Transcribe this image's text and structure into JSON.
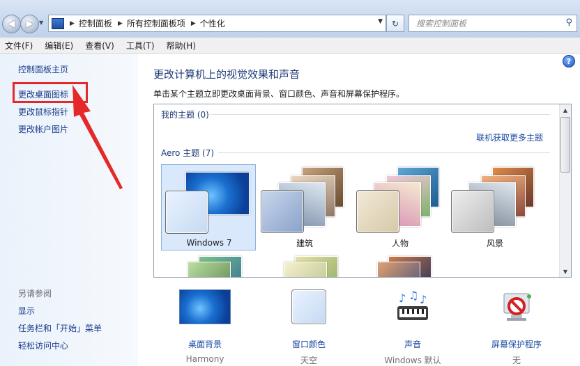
{
  "address": {
    "crumbs": [
      "控制面板",
      "所有控制面板项",
      "个性化"
    ],
    "search_placeholder": "搜索控制面板"
  },
  "menu": [
    "文件(F)",
    "编辑(E)",
    "查看(V)",
    "工具(T)",
    "帮助(H)"
  ],
  "left": {
    "links": [
      "控制面板主页",
      "更改桌面图标",
      "更改鼠标指针",
      "更改帐户图片"
    ],
    "see_also_title": "另请参阅",
    "see_also": [
      "显示",
      "任务栏和「开始」菜单",
      "轻松访问中心"
    ]
  },
  "main": {
    "heading": "更改计算机上的视觉效果和声音",
    "subheading": "单击某个主题立即更改桌面背景、窗口颜色、声音和屏幕保护程序。",
    "my_themes": "我的主题 (0)",
    "online_link": "联机获取更多主题",
    "aero_themes": "Aero 主题 (7)",
    "themes": [
      "Windows 7",
      "建筑",
      "人物",
      "风景"
    ]
  },
  "bottom": [
    {
      "label": "桌面背景",
      "value": "Harmony",
      "icon": "desktop-background-icon"
    },
    {
      "label": "窗口颜色",
      "value": "天空",
      "icon": "window-color-icon"
    },
    {
      "label": "声音",
      "value": "Windows 默认",
      "icon": "sound-icon"
    },
    {
      "label": "屏幕保护程序",
      "value": "无",
      "icon": "screensaver-icon"
    }
  ],
  "colors": {
    "link": "#1a3a8a",
    "heading": "#1e3a78",
    "highlight": "#e5292a",
    "selected": "#d9e8fb"
  }
}
